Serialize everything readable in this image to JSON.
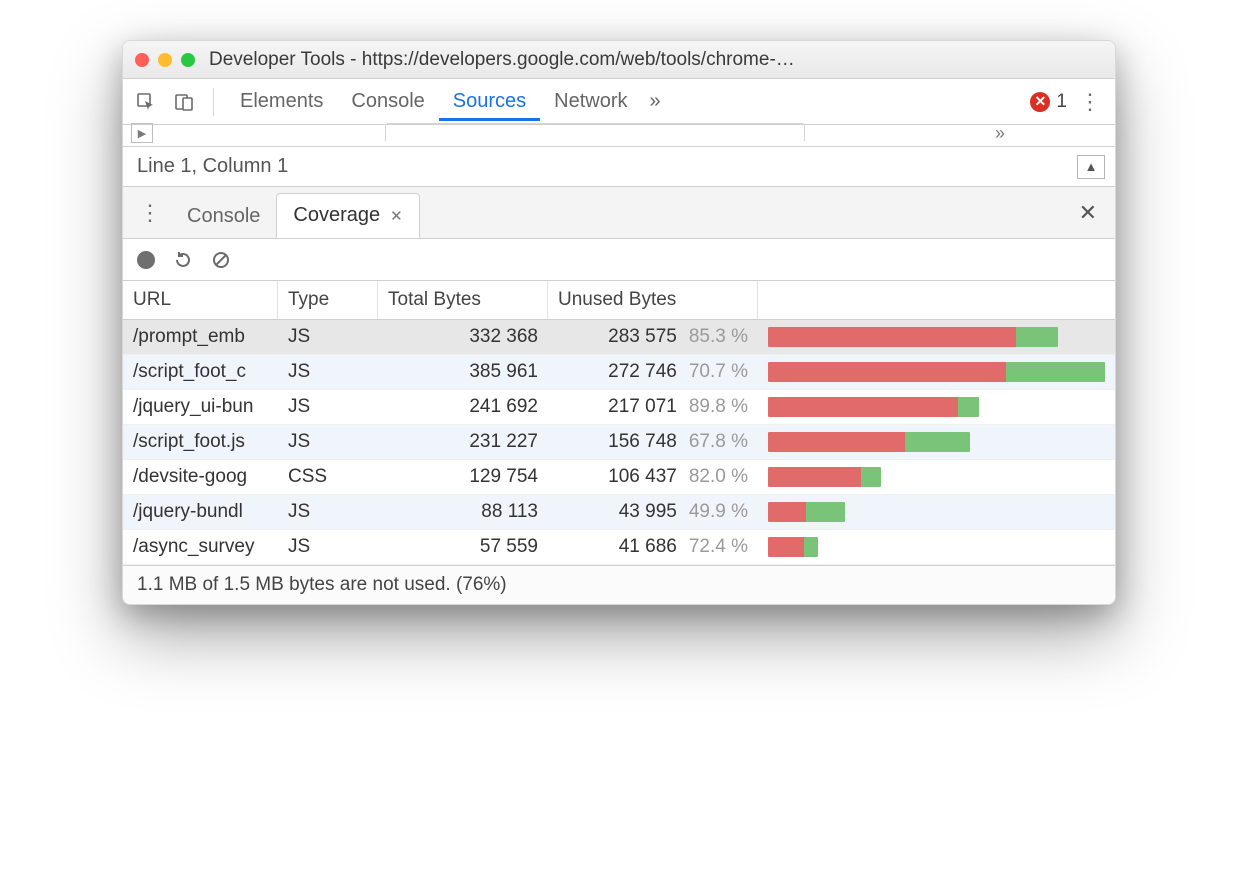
{
  "colors": {
    "unused": "#e16b6b",
    "used": "#7ac47a"
  },
  "window": {
    "title": "Developer Tools - https://developers.google.com/web/tools/chrome-…"
  },
  "main_tabs": {
    "items": [
      "Elements",
      "Console",
      "Sources",
      "Network"
    ],
    "active_index": 2,
    "overflow_glyph": "»",
    "error_count": "1"
  },
  "status": {
    "line_col": "Line 1, Column 1"
  },
  "drawer": {
    "tabs": [
      "Console",
      "Coverage"
    ],
    "active_index": 1
  },
  "coverage": {
    "headers": {
      "url": "URL",
      "type": "Type",
      "total": "Total Bytes",
      "unused": "Unused Bytes"
    },
    "max_total": 385961,
    "rows": [
      {
        "url": "/prompt_emb",
        "type": "JS",
        "total": "332 368",
        "unused": "283 575",
        "pct": "85.3 %",
        "total_n": 332368,
        "unused_n": 283575,
        "selected": true
      },
      {
        "url": "/script_foot_c",
        "type": "JS",
        "total": "385 961",
        "unused": "272 746",
        "pct": "70.7 %",
        "total_n": 385961,
        "unused_n": 272746
      },
      {
        "url": "/jquery_ui-bun",
        "type": "JS",
        "total": "241 692",
        "unused": "217 071",
        "pct": "89.8 %",
        "total_n": 241692,
        "unused_n": 217071
      },
      {
        "url": "/script_foot.js",
        "type": "JS",
        "total": "231 227",
        "unused": "156 748",
        "pct": "67.8 %",
        "total_n": 231227,
        "unused_n": 156748
      },
      {
        "url": "/devsite-goog",
        "type": "CSS",
        "total": "129 754",
        "unused": "106 437",
        "pct": "82.0 %",
        "total_n": 129754,
        "unused_n": 106437
      },
      {
        "url": "/jquery-bundl",
        "type": "JS",
        "total": "88 113",
        "unused": "43 995",
        "pct": "49.9 %",
        "total_n": 88113,
        "unused_n": 43995
      },
      {
        "url": "/async_survey",
        "type": "JS",
        "total": "57 559",
        "unused": "41 686",
        "pct": "72.4 %",
        "total_n": 57559,
        "unused_n": 41686
      }
    ],
    "footer": "1.1 MB of 1.5 MB bytes are not used. (76%)"
  }
}
